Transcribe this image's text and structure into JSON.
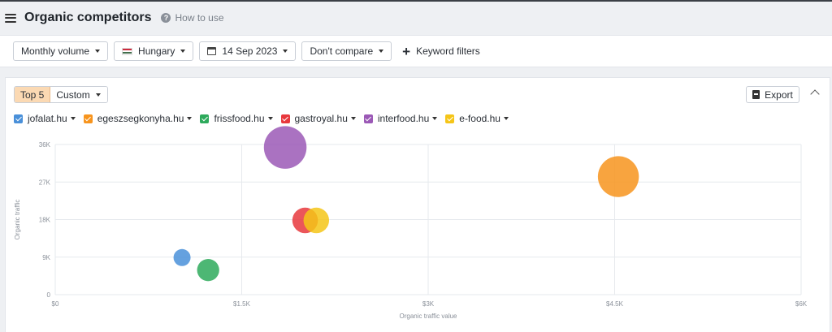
{
  "header": {
    "title": "Organic competitors",
    "help_label": "How to use"
  },
  "filters": {
    "volume_label": "Monthly volume",
    "country_label": "Hungary",
    "date_label": "14 Sep 2023",
    "compare_label": "Don't compare",
    "keyword_filters_label": "Keyword filters"
  },
  "panel": {
    "segment_top": "Top 5",
    "segment_custom": "Custom",
    "export_label": "Export"
  },
  "colors": {
    "accent": "#fbd9b3",
    "jofalat": "#4a90d9",
    "egeszsegkonyha": "#f7941d",
    "frissfood": "#2eaa5c",
    "gastroyal": "#e8383d",
    "interfood": "#9b59b6",
    "efood": "#f5c518"
  },
  "chart_data": {
    "type": "scatter",
    "title": "",
    "xlabel": "Organic traffic value",
    "ylabel": "Organic traffic",
    "xlim": [
      0,
      6000
    ],
    "ylim": [
      0,
      36000
    ],
    "x_ticks": [
      "$0",
      "$1.5K",
      "$3K",
      "$4.5K",
      "$6K"
    ],
    "y_ticks": [
      "0",
      "9K",
      "18K",
      "27K",
      "36K"
    ],
    "grid": true,
    "legend_position": "top-left",
    "series": [
      {
        "name": "jofalat.hu",
        "color": "#4a90d9",
        "x": 1020,
        "y": 8900,
        "size": 1
      },
      {
        "name": "egeszsegkonyha.hu",
        "color": "#f7941d",
        "x": 4530,
        "y": 28300,
        "size": 2.4
      },
      {
        "name": "frissfood.hu",
        "color": "#2eaa5c",
        "x": 1230,
        "y": 5900,
        "size": 1.3
      },
      {
        "name": "gastroyal.hu",
        "color": "#e8383d",
        "x": 2010,
        "y": 17800,
        "size": 1.5
      },
      {
        "name": "interfood.hu",
        "color": "#9b59b6",
        "x": 1850,
        "y": 35300,
        "size": 2.5
      },
      {
        "name": "e-food.hu",
        "color": "#f5c518",
        "x": 2100,
        "y": 17800,
        "size": 1.5
      }
    ]
  }
}
